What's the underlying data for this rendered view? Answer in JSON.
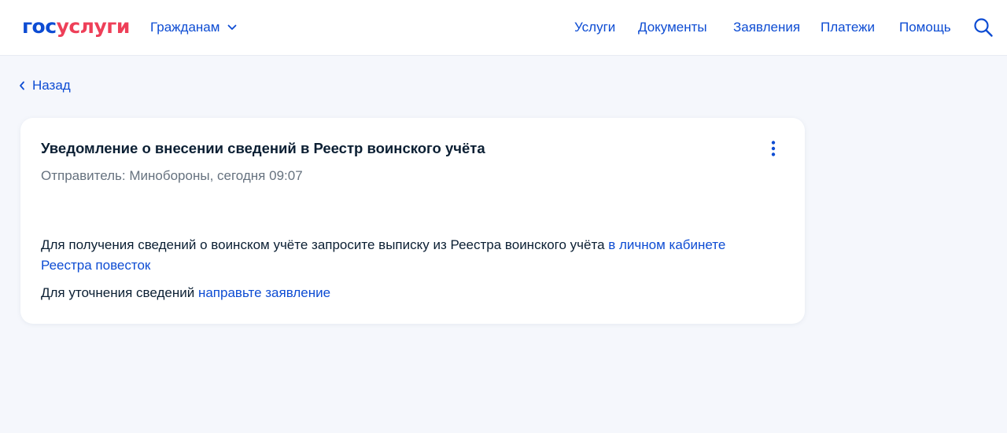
{
  "header": {
    "logo": {
      "part1": "гос",
      "part2": "услуги"
    },
    "audience_label": "Гражданам",
    "nav": [
      "Услуги",
      "Документы",
      "Заявления",
      "Платежи",
      "Помощь"
    ]
  },
  "back_label": "Назад",
  "notification": {
    "title": "Уведомление о внесении сведений в Реестр воинского учёта",
    "sender": "Отправитель: Минобороны, сегодня 09:07",
    "para1_text": "Для получения сведений о воинском учёте запросите выписку из Реестра воинского учёта ",
    "para1_link": "в личном кабинете Реестра повесток",
    "para2_text": "Для уточнения сведений ",
    "para2_link": "направьте заявление"
  },
  "colors": {
    "brand_blue": "#0d4cd3",
    "brand_red": "#ee3f58",
    "text_primary": "#0b1f33",
    "text_secondary": "#66727f",
    "page_bg": "#f5f7fc"
  },
  "icons": {
    "audience_dropdown": "chevron-down-icon",
    "search": "search-icon",
    "back": "chevron-left-icon",
    "more": "kebab-menu-icon"
  }
}
